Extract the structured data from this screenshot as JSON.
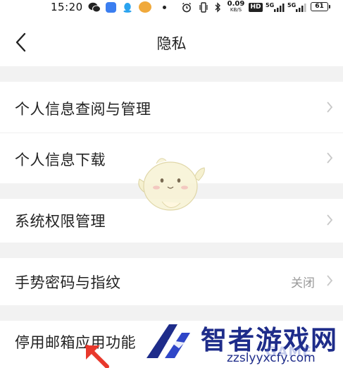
{
  "status_bar": {
    "time": "15:20",
    "net_speed_value": "0.09",
    "net_speed_unit": "KB/S",
    "hd_label": "HD",
    "signal_1_label": "5G",
    "signal_2_label": "5G",
    "battery_level": "61"
  },
  "header": {
    "title": "隐私",
    "back_icon": "chevron-left-icon"
  },
  "settings": {
    "items": [
      {
        "label": "个人信息查阅与管理",
        "value": ""
      },
      {
        "label": "个人信息下载",
        "value": ""
      },
      {
        "label": "系统权限管理",
        "value": ""
      },
      {
        "label": "手势密码与指纹",
        "value": "关闭"
      },
      {
        "label": "停用邮箱应用功能",
        "value": ""
      }
    ]
  },
  "watermark": {
    "brand": "智者游戏网",
    "url": "zzslyyxcfy.com",
    "faded": "GAME"
  },
  "colors": {
    "section_gap": "#f2f2f2",
    "chevron": "#c8c8c8",
    "watermark_blue": "#1e2c8a",
    "annotation_arrow": "#e8382c"
  }
}
